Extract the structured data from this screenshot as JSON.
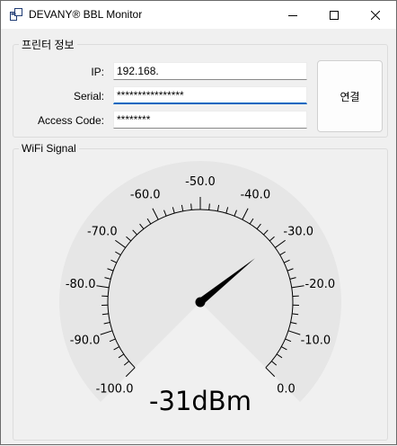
{
  "window": {
    "title": "DEVANY® BBL Monitor"
  },
  "printer_info": {
    "legend": "프린터 정보",
    "ip_label": "IP:",
    "ip_value": "192.168.",
    "serial_label": "Serial:",
    "serial_value": "****************",
    "access_label": "Access Code:",
    "access_value": "********",
    "connect_label": "연결"
  },
  "wifi": {
    "legend": "WiFi Signal",
    "gauge": {
      "min": -100,
      "max": 0,
      "value": -31,
      "unit": "dBm",
      "readout": "-31dBm",
      "tick_labels": [
        "-100.0",
        "-90.0",
        "-80.0",
        "-70.0",
        "-60.0",
        "-50.0",
        "-40.0",
        "-30.0",
        "-20.0",
        "-10.0",
        "0.0"
      ],
      "colors": {
        "face": "#e6e6e6",
        "ticks": "#000000",
        "needle": "#000000"
      }
    }
  }
}
